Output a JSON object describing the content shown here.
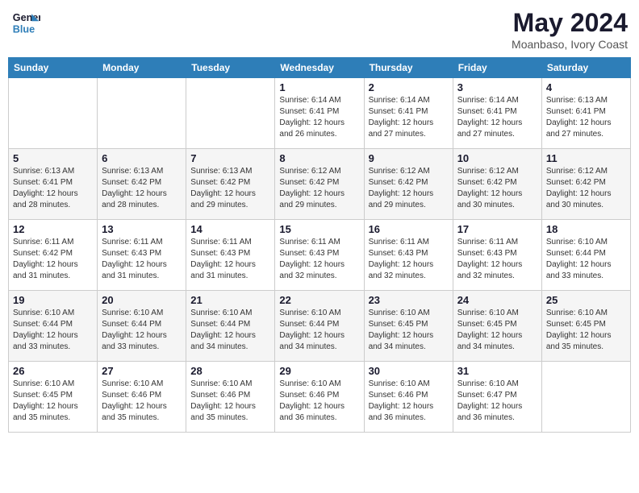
{
  "header": {
    "logo_line1": "General",
    "logo_line2": "Blue",
    "month": "May 2024",
    "location": "Moanbaso, Ivory Coast"
  },
  "days_of_week": [
    "Sunday",
    "Monday",
    "Tuesday",
    "Wednesday",
    "Thursday",
    "Friday",
    "Saturday"
  ],
  "weeks": [
    [
      {
        "day": "",
        "sunrise": "",
        "sunset": "",
        "daylight": ""
      },
      {
        "day": "",
        "sunrise": "",
        "sunset": "",
        "daylight": ""
      },
      {
        "day": "",
        "sunrise": "",
        "sunset": "",
        "daylight": ""
      },
      {
        "day": "1",
        "sunrise": "Sunrise: 6:14 AM",
        "sunset": "Sunset: 6:41 PM",
        "daylight": "Daylight: 12 hours and 26 minutes."
      },
      {
        "day": "2",
        "sunrise": "Sunrise: 6:14 AM",
        "sunset": "Sunset: 6:41 PM",
        "daylight": "Daylight: 12 hours and 27 minutes."
      },
      {
        "day": "3",
        "sunrise": "Sunrise: 6:14 AM",
        "sunset": "Sunset: 6:41 PM",
        "daylight": "Daylight: 12 hours and 27 minutes."
      },
      {
        "day": "4",
        "sunrise": "Sunrise: 6:13 AM",
        "sunset": "Sunset: 6:41 PM",
        "daylight": "Daylight: 12 hours and 27 minutes."
      }
    ],
    [
      {
        "day": "5",
        "sunrise": "Sunrise: 6:13 AM",
        "sunset": "Sunset: 6:41 PM",
        "daylight": "Daylight: 12 hours and 28 minutes."
      },
      {
        "day": "6",
        "sunrise": "Sunrise: 6:13 AM",
        "sunset": "Sunset: 6:42 PM",
        "daylight": "Daylight: 12 hours and 28 minutes."
      },
      {
        "day": "7",
        "sunrise": "Sunrise: 6:13 AM",
        "sunset": "Sunset: 6:42 PM",
        "daylight": "Daylight: 12 hours and 29 minutes."
      },
      {
        "day": "8",
        "sunrise": "Sunrise: 6:12 AM",
        "sunset": "Sunset: 6:42 PM",
        "daylight": "Daylight: 12 hours and 29 minutes."
      },
      {
        "day": "9",
        "sunrise": "Sunrise: 6:12 AM",
        "sunset": "Sunset: 6:42 PM",
        "daylight": "Daylight: 12 hours and 29 minutes."
      },
      {
        "day": "10",
        "sunrise": "Sunrise: 6:12 AM",
        "sunset": "Sunset: 6:42 PM",
        "daylight": "Daylight: 12 hours and 30 minutes."
      },
      {
        "day": "11",
        "sunrise": "Sunrise: 6:12 AM",
        "sunset": "Sunset: 6:42 PM",
        "daylight": "Daylight: 12 hours and 30 minutes."
      }
    ],
    [
      {
        "day": "12",
        "sunrise": "Sunrise: 6:11 AM",
        "sunset": "Sunset: 6:42 PM",
        "daylight": "Daylight: 12 hours and 31 minutes."
      },
      {
        "day": "13",
        "sunrise": "Sunrise: 6:11 AM",
        "sunset": "Sunset: 6:43 PM",
        "daylight": "Daylight: 12 hours and 31 minutes."
      },
      {
        "day": "14",
        "sunrise": "Sunrise: 6:11 AM",
        "sunset": "Sunset: 6:43 PM",
        "daylight": "Daylight: 12 hours and 31 minutes."
      },
      {
        "day": "15",
        "sunrise": "Sunrise: 6:11 AM",
        "sunset": "Sunset: 6:43 PM",
        "daylight": "Daylight: 12 hours and 32 minutes."
      },
      {
        "day": "16",
        "sunrise": "Sunrise: 6:11 AM",
        "sunset": "Sunset: 6:43 PM",
        "daylight": "Daylight: 12 hours and 32 minutes."
      },
      {
        "day": "17",
        "sunrise": "Sunrise: 6:11 AM",
        "sunset": "Sunset: 6:43 PM",
        "daylight": "Daylight: 12 hours and 32 minutes."
      },
      {
        "day": "18",
        "sunrise": "Sunrise: 6:10 AM",
        "sunset": "Sunset: 6:44 PM",
        "daylight": "Daylight: 12 hours and 33 minutes."
      }
    ],
    [
      {
        "day": "19",
        "sunrise": "Sunrise: 6:10 AM",
        "sunset": "Sunset: 6:44 PM",
        "daylight": "Daylight: 12 hours and 33 minutes."
      },
      {
        "day": "20",
        "sunrise": "Sunrise: 6:10 AM",
        "sunset": "Sunset: 6:44 PM",
        "daylight": "Daylight: 12 hours and 33 minutes."
      },
      {
        "day": "21",
        "sunrise": "Sunrise: 6:10 AM",
        "sunset": "Sunset: 6:44 PM",
        "daylight": "Daylight: 12 hours and 34 minutes."
      },
      {
        "day": "22",
        "sunrise": "Sunrise: 6:10 AM",
        "sunset": "Sunset: 6:44 PM",
        "daylight": "Daylight: 12 hours and 34 minutes."
      },
      {
        "day": "23",
        "sunrise": "Sunrise: 6:10 AM",
        "sunset": "Sunset: 6:45 PM",
        "daylight": "Daylight: 12 hours and 34 minutes."
      },
      {
        "day": "24",
        "sunrise": "Sunrise: 6:10 AM",
        "sunset": "Sunset: 6:45 PM",
        "daylight": "Daylight: 12 hours and 34 minutes."
      },
      {
        "day": "25",
        "sunrise": "Sunrise: 6:10 AM",
        "sunset": "Sunset: 6:45 PM",
        "daylight": "Daylight: 12 hours and 35 minutes."
      }
    ],
    [
      {
        "day": "26",
        "sunrise": "Sunrise: 6:10 AM",
        "sunset": "Sunset: 6:45 PM",
        "daylight": "Daylight: 12 hours and 35 minutes."
      },
      {
        "day": "27",
        "sunrise": "Sunrise: 6:10 AM",
        "sunset": "Sunset: 6:46 PM",
        "daylight": "Daylight: 12 hours and 35 minutes."
      },
      {
        "day": "28",
        "sunrise": "Sunrise: 6:10 AM",
        "sunset": "Sunset: 6:46 PM",
        "daylight": "Daylight: 12 hours and 35 minutes."
      },
      {
        "day": "29",
        "sunrise": "Sunrise: 6:10 AM",
        "sunset": "Sunset: 6:46 PM",
        "daylight": "Daylight: 12 hours and 36 minutes."
      },
      {
        "day": "30",
        "sunrise": "Sunrise: 6:10 AM",
        "sunset": "Sunset: 6:46 PM",
        "daylight": "Daylight: 12 hours and 36 minutes."
      },
      {
        "day": "31",
        "sunrise": "Sunrise: 6:10 AM",
        "sunset": "Sunset: 6:47 PM",
        "daylight": "Daylight: 12 hours and 36 minutes."
      },
      {
        "day": "",
        "sunrise": "",
        "sunset": "",
        "daylight": ""
      }
    ]
  ]
}
